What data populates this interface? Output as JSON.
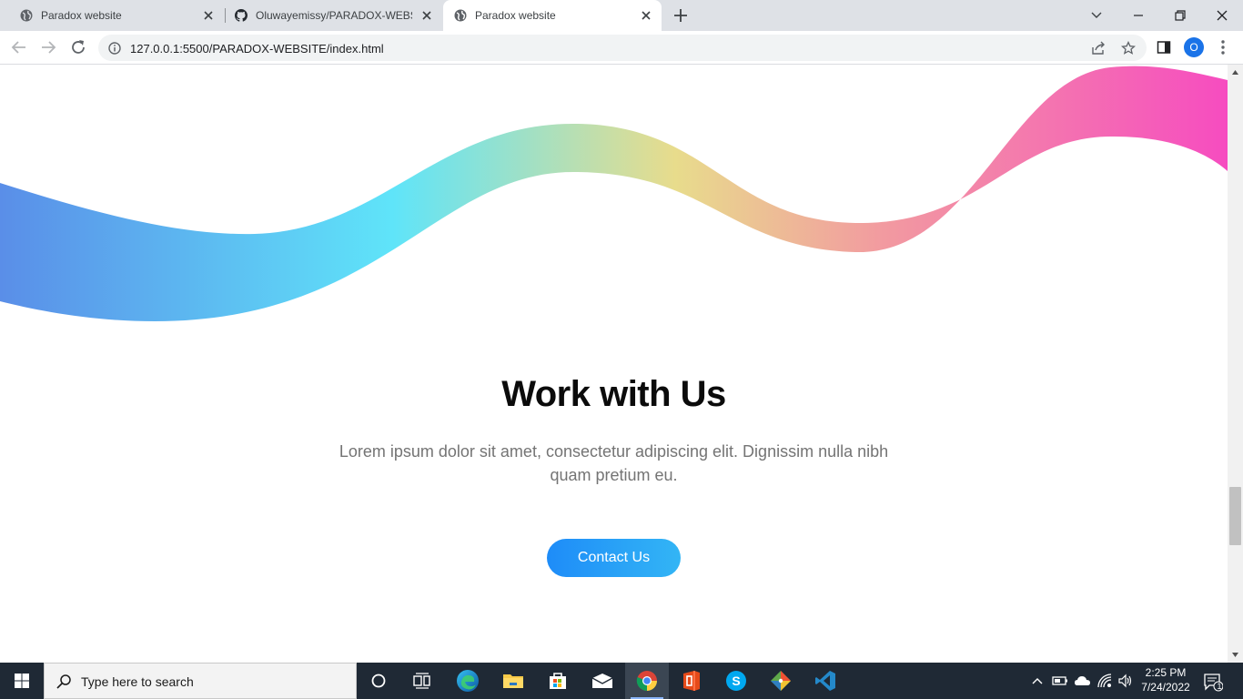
{
  "browser": {
    "tabs": [
      {
        "title": "Paradox website",
        "active": false
      },
      {
        "title": "Oluwayemissy/PARADOX-WEBSI",
        "active": false
      },
      {
        "title": "Paradox website",
        "active": true
      }
    ],
    "url": "127.0.0.1:5500/PARADOX-WEBSITE/index.html",
    "profile_initial": "O"
  },
  "page": {
    "cta": {
      "title": "Work with Us",
      "text": "Lorem ipsum dolor sit amet, consectetur adipiscing elit. Dignissim nulla nibh quam pretium eu.",
      "button_label": "Contact Us"
    },
    "scroll_position_fraction": 0.8,
    "wave_colors": [
      "#5a8ee8",
      "#5fe4f9",
      "#e8dc8c",
      "#f29aa0",
      "#f64cc0"
    ]
  },
  "taskbar": {
    "search_placeholder": "Type here to search",
    "time": "2:25 PM",
    "date": "7/24/2022",
    "notification_count": "1",
    "pinned": [
      "cortana-icon",
      "task-view-icon",
      "edge-icon",
      "file-explorer-icon",
      "store-icon",
      "mail-icon",
      "chrome-icon",
      "office-icon",
      "skype-icon",
      "git-icon",
      "vscode-icon"
    ],
    "active_app": "chrome-icon"
  }
}
